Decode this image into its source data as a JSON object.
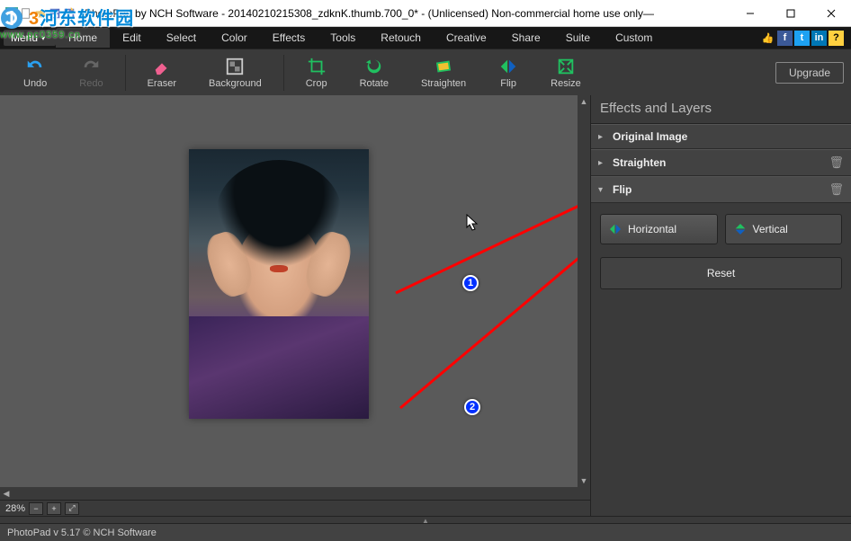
{
  "titlebar": {
    "text": "PhotoPad by NCH Software - 20140210215308_zdknK.thumb.700_0* - (Unlicensed) Non-commercial home use only—"
  },
  "menubar": {
    "menu_label": "Menu",
    "tabs": [
      "Home",
      "Edit",
      "Select",
      "Color",
      "Effects",
      "Tools",
      "Retouch",
      "Creative",
      "Share",
      "Suite",
      "Custom"
    ],
    "active_index": 0
  },
  "toolbar": {
    "undo_label": "Undo",
    "redo_label": "Redo",
    "eraser_label": "Eraser",
    "background_label": "Background",
    "crop_label": "Crop",
    "rotate_label": "Rotate",
    "straighten_label": "Straighten",
    "flip_label": "Flip",
    "resize_label": "Resize",
    "upgrade_label": "Upgrade"
  },
  "panel": {
    "title": "Effects and Layers",
    "rows": [
      {
        "label": "Original Image",
        "expanded": false,
        "deletable": false
      },
      {
        "label": "Straighten",
        "expanded": false,
        "deletable": true
      },
      {
        "label": "Flip",
        "expanded": true,
        "deletable": true
      }
    ],
    "flip": {
      "horizontal_label": "Horizontal",
      "vertical_label": "Vertical",
      "reset_label": "Reset"
    }
  },
  "zoom": {
    "percent_label": "28%"
  },
  "status": {
    "text": "PhotoPad v 5.17  © NCH Software"
  },
  "watermark": {
    "brand_main": "河东软件园",
    "brand_num": "3",
    "url": "www.pc0359.cn"
  },
  "annotations": {
    "badge1": "1",
    "badge2": "2"
  }
}
